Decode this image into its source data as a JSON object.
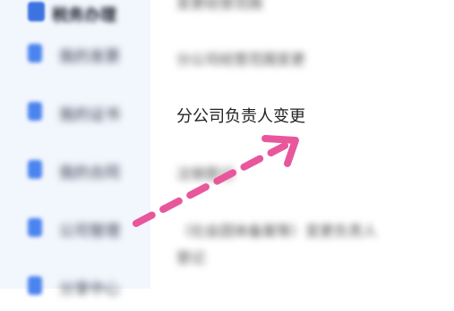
{
  "sidebar": {
    "top_item": {
      "label": "税务办理",
      "icon": "document-icon"
    },
    "items": [
      {
        "label": "我的发票",
        "icon": "document-icon"
      },
      {
        "label": "我的证书",
        "icon": "document-icon"
      },
      {
        "label": "我的合同",
        "icon": "document-icon"
      },
      {
        "label": "公司管理",
        "icon": "folder-icon"
      },
      {
        "label": "分享中心",
        "icon": "document-icon"
      }
    ]
  },
  "content": {
    "rows": [
      {
        "text": "变更经营范围"
      },
      {
        "text": "分公司经营范围变更"
      },
      {
        "text": "分公司负责人变更"
      },
      {
        "text": "注销登记"
      },
      {
        "text": "（社会团体备案等）变更负责人"
      },
      {
        "text": "登记"
      }
    ]
  },
  "annotation": {
    "color": "#e8579b"
  }
}
